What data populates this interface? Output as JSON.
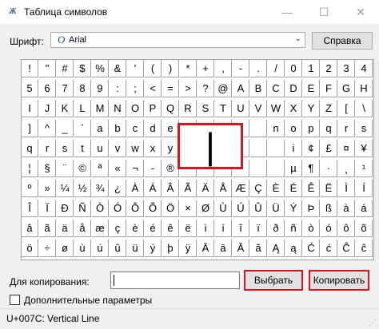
{
  "window": {
    "title": "Таблица символов",
    "app_icon": "charmap-app-icon",
    "minimize": "—",
    "maximize": "☐",
    "close": "✕"
  },
  "font": {
    "label": "Шрифт:",
    "icon": "O",
    "selected": "Arial",
    "help_label": "Справка"
  },
  "grid": {
    "rows": [
      [
        "!",
        "\"",
        "#",
        "$",
        "%",
        "&",
        "'",
        "(",
        ")",
        "*",
        "+",
        ",",
        "-",
        ".",
        "/",
        "0",
        "1",
        "2",
        "3",
        "4"
      ],
      [
        "5",
        "6",
        "7",
        "8",
        "9",
        ":",
        ";",
        "<",
        "=",
        ">",
        "?",
        "@",
        "A",
        "B",
        "C",
        "D",
        "E",
        "F",
        "G",
        "H"
      ],
      [
        "I",
        "J",
        "K",
        "L",
        "M",
        "N",
        "O",
        "P",
        "Q",
        "R",
        "S",
        "T",
        "U",
        "V",
        "W",
        "X",
        "Y",
        "Z",
        "[",
        "\\"
      ],
      [
        "]",
        "^",
        "_",
        "`",
        "a",
        "b",
        "c",
        "d",
        "e",
        "",
        "",
        "",
        "",
        "",
        "n",
        "o",
        "p",
        "q",
        "r",
        "s"
      ],
      [
        "q",
        "r",
        "s",
        "t",
        "u",
        "v",
        "w",
        "x",
        "y",
        "",
        "",
        "",
        "",
        "",
        "",
        "i",
        "¢",
        "£",
        "¤",
        "¥"
      ],
      [
        "¦",
        "§",
        "¨",
        "©",
        "ª",
        "«",
        "¬",
        "-",
        "®",
        "",
        "",
        "",
        "",
        "",
        "",
        "µ",
        "¶",
        "·",
        "¸",
        "¹"
      ],
      [
        "º",
        "»",
        "¼",
        "½",
        "¾",
        "¿",
        "À",
        "Á",
        "Â",
        "Ã",
        "Ä",
        "Å",
        "Æ",
        "Ç",
        "È",
        "É",
        "Ê",
        "Ë",
        "Ì",
        "Í"
      ],
      [
        "Î",
        "Ï",
        "Ð",
        "Ñ",
        "Ò",
        "Ó",
        "Ô",
        "Õ",
        "Ö",
        "×",
        "Ø",
        "Ù",
        "Ú",
        "Û",
        "Ü",
        "Ý",
        "Þ",
        "ß",
        "à",
        "á"
      ],
      [
        "â",
        "ã",
        "ä",
        "å",
        "æ",
        "ç",
        "è",
        "é",
        "ê",
        "ë",
        "ì",
        "í",
        "î",
        "ï",
        "ð",
        "ñ",
        "ò",
        "ó",
        "ô",
        "õ"
      ],
      [
        "ö",
        "÷",
        "ø",
        "ù",
        "ú",
        "û",
        "ü",
        "ý",
        "þ",
        "ÿ",
        "Ā",
        "ā",
        "Ă",
        "ă",
        "Ą",
        "ą",
        "Ć",
        "ć",
        "Ĉ",
        "ĉ"
      ]
    ],
    "magnified_char": "|",
    "scroll_up_icon": "▲",
    "scroll_down_icon": "▼"
  },
  "copy": {
    "label": "Для копирования:",
    "value": "",
    "select_label": "Выбрать",
    "copy_label": "Копировать"
  },
  "advanced": {
    "label": "Дополнительные параметры",
    "checked": false
  },
  "status": {
    "text": "U+007C: Vertical Line"
  },
  "colors": {
    "highlight_border": "#d9161f"
  }
}
